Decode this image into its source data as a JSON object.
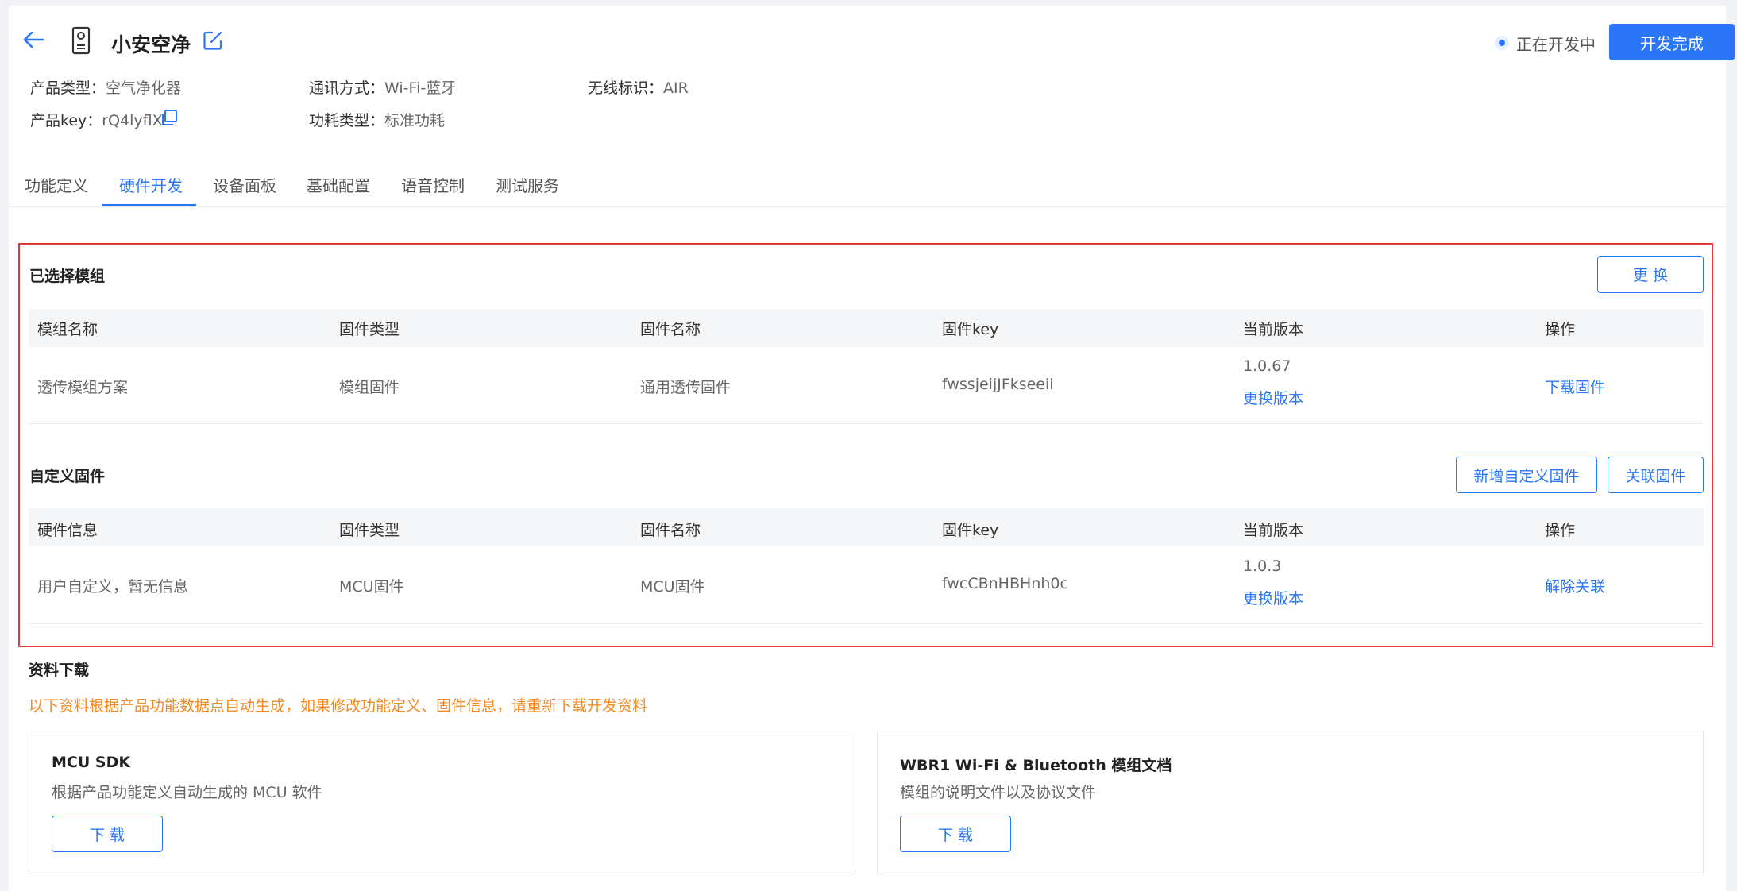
{
  "header": {
    "title": "小安空净",
    "status_text": "正在开发中",
    "finish_button": "开发完成"
  },
  "meta": {
    "product_type_label": "产品类型：",
    "product_type_value": "空气净化器",
    "comm_label": "通讯方式：",
    "comm_value": "Wi-Fi-蓝牙",
    "wireless_label": "无线标识：",
    "wireless_value": "AIR",
    "key_label": "产品key：",
    "key_value": "rQ4lyflX",
    "power_label": "功耗类型：",
    "power_value": "标准功耗"
  },
  "tabs": [
    {
      "label": "功能定义"
    },
    {
      "label": "硬件开发"
    },
    {
      "label": "设备面板"
    },
    {
      "label": "基础配置"
    },
    {
      "label": "语音控制"
    },
    {
      "label": "测试服务"
    }
  ],
  "selected_module": {
    "title": "已选择模组",
    "change_button": "更 换",
    "columns": [
      "模组名称",
      "固件类型",
      "固件名称",
      "固件key",
      "当前版本",
      "操作"
    ],
    "row": {
      "name": "透传模组方案",
      "type": "模组固件",
      "firmware": "通用透传固件",
      "key": "fwssjeijJFkseeii",
      "version": "1.0.67",
      "change_version": "更换版本",
      "action": "下载固件"
    }
  },
  "custom_firmware": {
    "title": "自定义固件",
    "add_button": "新增自定义固件",
    "link_button": "关联固件",
    "columns": [
      "硬件信息",
      "固件类型",
      "固件名称",
      "固件key",
      "当前版本",
      "操作"
    ],
    "row": {
      "name": "用户自定义，暂无信息",
      "type": "MCU固件",
      "firmware": "MCU固件",
      "key": "fwcCBnHBHnh0c",
      "version": "1.0.3",
      "change_version": "更换版本",
      "action": "解除关联"
    }
  },
  "downloads": {
    "title": "资料下载",
    "notice": "以下资料根据产品功能数据点自动生成，如果修改功能定义、固件信息，请重新下载开发资料",
    "cards": [
      {
        "title": "MCU SDK",
        "desc": "根据产品功能定义自动生成的 MCU 软件",
        "button": "下 载"
      },
      {
        "title": "WBR1 Wi-Fi & Bluetooth 模组文档",
        "desc": "模组的说明文件以及协议文件",
        "button": "下 载"
      }
    ]
  },
  "colors": {
    "accent": "#2a76f7",
    "warning": "#f08a24",
    "highlight": "#e53935"
  },
  "icons": [
    "back-arrow-icon",
    "device-icon",
    "edit-icon",
    "copy-icon"
  ]
}
